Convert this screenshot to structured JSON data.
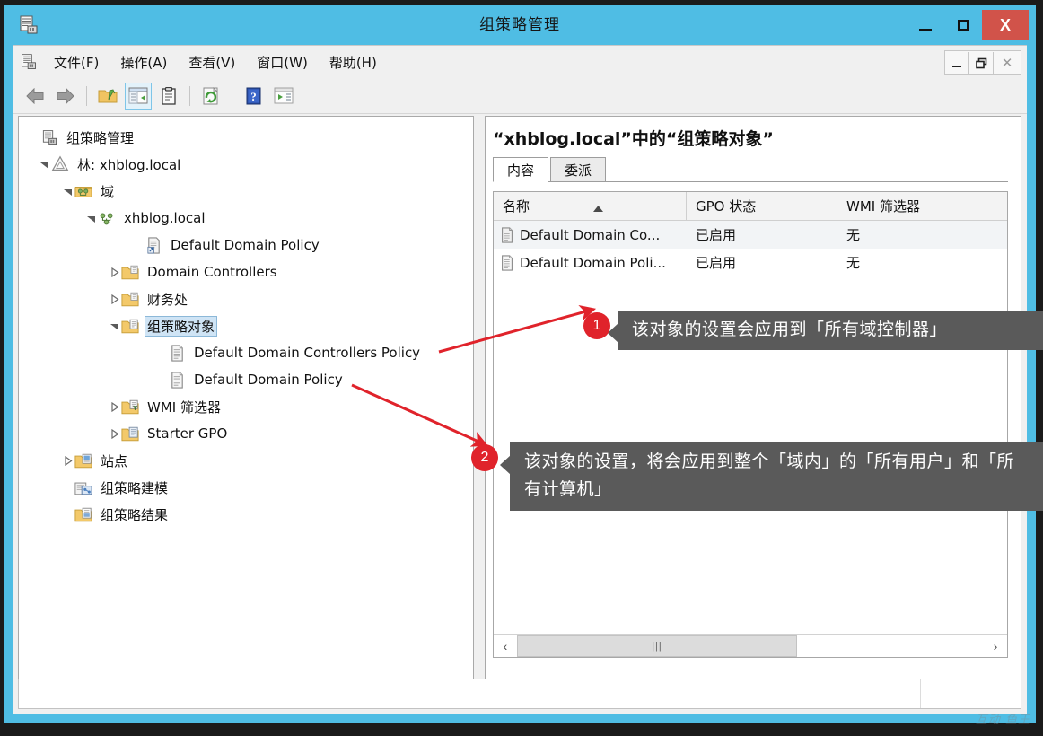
{
  "window": {
    "title": "组策略管理",
    "icon": "gpmc-icon",
    "controls": {
      "minimize": "–",
      "maximize": "□",
      "close": "X"
    }
  },
  "menubar": {
    "items": [
      {
        "label": "文件(F)",
        "mnemonic": "F"
      },
      {
        "label": "操作(A)",
        "mnemonic": "A"
      },
      {
        "label": "查看(V)",
        "mnemonic": "V"
      },
      {
        "label": "窗口(W)",
        "mnemonic": "W"
      },
      {
        "label": "帮助(H)",
        "mnemonic": "H"
      }
    ],
    "mdi_controls": {
      "minimize": "–",
      "restore": "❐",
      "close": "✕"
    }
  },
  "toolbar": {
    "buttons": [
      {
        "name": "back-icon",
        "label": "后退"
      },
      {
        "name": "forward-icon",
        "label": "前进"
      },
      {
        "name": "up-folder-icon",
        "label": "上移一级"
      },
      {
        "name": "show-hide-console-tree-icon",
        "label": "显示/隐藏控制台树",
        "active": true
      },
      {
        "name": "properties-clipboard-icon",
        "label": "属性"
      },
      {
        "name": "refresh-icon",
        "label": "刷新"
      },
      {
        "name": "help-icon",
        "label": "帮助"
      },
      {
        "name": "show-action-pane-icon",
        "label": "显示/隐藏操作窗格"
      }
    ]
  },
  "tree": {
    "nodes": [
      {
        "label": "组策略管理",
        "indent": 0,
        "arrow": "none",
        "icon": "gpmc-icon",
        "selected": false
      },
      {
        "label": "林: xhblog.local",
        "indent": 1,
        "arrow": "open",
        "icon": "forest-icon",
        "selected": false
      },
      {
        "label": "域",
        "indent": 2,
        "arrow": "open",
        "icon": "domains-icon",
        "selected": false
      },
      {
        "label": "xhblog.local",
        "indent": 3,
        "arrow": "open",
        "icon": "domain-icon",
        "selected": false
      },
      {
        "label": "Default Domain Policy",
        "indent": 5,
        "arrow": "none",
        "icon": "gpo-link-icon",
        "selected": false
      },
      {
        "label": "Domain Controllers",
        "indent": 4,
        "arrow": "closed",
        "icon": "ou-icon",
        "selected": false
      },
      {
        "label": "财务处",
        "indent": 4,
        "arrow": "closed",
        "icon": "ou-icon",
        "selected": false
      },
      {
        "label": "组策略对象",
        "indent": 4,
        "arrow": "open",
        "icon": "gpo-folder-icon",
        "selected": true
      },
      {
        "label": "Default Domain Controllers Policy",
        "indent": 6,
        "arrow": "none",
        "icon": "gpo-icon",
        "selected": false
      },
      {
        "label": "Default Domain Policy",
        "indent": 6,
        "arrow": "none",
        "icon": "gpo-icon",
        "selected": false
      },
      {
        "label": "WMI 筛选器",
        "indent": 4,
        "arrow": "closed",
        "icon": "wmi-folder-icon",
        "selected": false
      },
      {
        "label": "Starter GPO",
        "indent": 4,
        "arrow": "closed",
        "icon": "starter-gpo-folder-icon",
        "selected": false
      },
      {
        "label": "站点",
        "indent": 2,
        "arrow": "closed",
        "icon": "sites-icon",
        "selected": false
      },
      {
        "label": "组策略建模",
        "indent": 2,
        "arrow": "none",
        "icon": "gp-modeling-icon",
        "selected": false
      },
      {
        "label": "组策略结果",
        "indent": 2,
        "arrow": "none",
        "icon": "gp-results-icon",
        "selected": false
      }
    ]
  },
  "detail": {
    "title": "“xhblog.local”中的“组策略对象”",
    "tabs": [
      {
        "label": "内容",
        "selected": true
      },
      {
        "label": "委派",
        "selected": false
      }
    ],
    "table": {
      "columns": [
        "名称",
        "GPO 状态",
        "WMI 筛选器"
      ],
      "sort_column": "名称",
      "sort_direction": "asc",
      "rows": [
        {
          "name": "Default Domain Co...",
          "gpo_status": "已启用",
          "wmi_filter": "无",
          "icon": "gpo-icon",
          "highlighted": true
        },
        {
          "name": "Default Domain Poli...",
          "gpo_status": "已启用",
          "wmi_filter": "无",
          "icon": "gpo-icon",
          "highlighted": false
        }
      ]
    },
    "hscroll": {
      "left_arrow": "‹",
      "right_arrow": "›",
      "thumb_grip": "|||"
    }
  },
  "statusbar": {
    "cell1": "",
    "cell2": "",
    "cell3": ""
  },
  "annotations": [
    {
      "badge": "1",
      "text": "该对象的设置会应用到「所有域控制器」",
      "points_to": "Default Domain Controllers Policy"
    },
    {
      "badge": "2",
      "text": "该对象的设置，将会应用到整个「域内」的「所有用户」和「所有计算机」",
      "points_to": "Default Domain Policy"
    }
  ],
  "watermark": "互动 鱼王",
  "colors": {
    "title_bar": "#4fbde4",
    "close_button": "#d1534a",
    "callout_bg": "#5a5a5a",
    "badge_bg": "#e0232b",
    "arrow_red": "#e0232b",
    "selection": "#cfe4f5",
    "toolbar_active": "#e3f2fa"
  }
}
